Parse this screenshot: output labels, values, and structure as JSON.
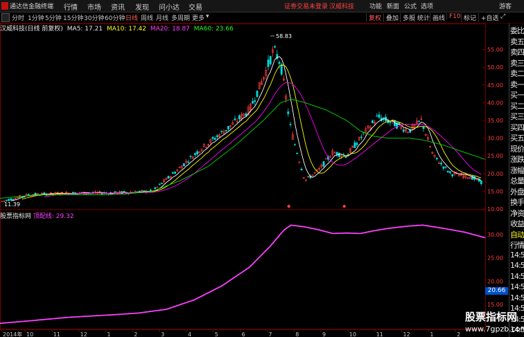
{
  "menubar": {
    "app_title": "通达信金融终端",
    "items": [
      "行情",
      "市场",
      "资讯",
      "发现",
      "问小达",
      "交易"
    ],
    "notice": "证劵交易未登录",
    "stock_name": "汉威科技",
    "right_items": [
      "功能",
      "新面",
      "公式",
      "选项"
    ],
    "user": "游客",
    "colors": {
      "notice": "#ff3030",
      "stock": "#ff3030"
    }
  },
  "toolbar": {
    "periods": [
      "分时",
      "1分钟",
      "5分钟",
      "15分钟",
      "30分钟",
      "60分钟",
      "日线",
      "周线",
      "月线",
      "多周期",
      "更多"
    ],
    "selected_period": "日线",
    "buttons": [
      "复权",
      "叠加",
      "多股",
      "统计",
      "画线",
      "F10",
      "标记",
      "+自选"
    ],
    "selected_buttons": [
      "复权",
      "F10"
    ]
  },
  "legend": {
    "title": "汉威科技(日线 前复权)",
    "ma5": "MA5: 17.21",
    "ma10": "MA10: 17.42",
    "ma20": "MA20: 18.87",
    "ma60": "MA60: 23.66",
    "colors": {
      "ma5": "#ffffff",
      "ma10": "#ffff00",
      "ma20": "#ff00ff",
      "ma60": "#00ff00"
    }
  },
  "sub_legend": {
    "name": "股票指标网",
    "indicator": "顶配线: 29.32",
    "value_tag": "20.66"
  },
  "price_axis": {
    "ticks": [
      "55.00",
      "50.00",
      "45.00",
      "40.00",
      "35.00",
      "30.00",
      "25.00",
      "20.00",
      "15.00",
      "10.00"
    ],
    "max_label": "58.83",
    "min_label": "11.39"
  },
  "sub_axis": {
    "ticks": [
      "30.00",
      "25.00",
      "20.00",
      "15.00"
    ]
  },
  "date_axis": {
    "labels": [
      "2014年",
      "10",
      "11",
      "12",
      "1",
      "2",
      "3",
      "4",
      "5",
      "6",
      "7",
      "8",
      "9",
      "10",
      "11",
      "12",
      "1",
      "2"
    ]
  },
  "right_panel": {
    "items": [
      {
        "t": "委比",
        "c": "wht"
      },
      {
        "t": "卖五",
        "c": "wht"
      },
      {
        "t": "卖四",
        "c": "wht"
      },
      {
        "t": "卖三",
        "c": "wht"
      },
      {
        "t": "卖二",
        "c": "wht"
      },
      {
        "t": "卖一",
        "c": "wht"
      },
      {
        "t": "买一",
        "c": "wht"
      },
      {
        "t": "买二",
        "c": "wht"
      },
      {
        "t": "买三",
        "c": "wht"
      },
      {
        "t": "买四",
        "c": "wht"
      },
      {
        "t": "买五",
        "c": "wht"
      },
      {
        "t": "现价",
        "c": "wht"
      },
      {
        "t": "涨跌",
        "c": "wht"
      },
      {
        "t": "涨幅",
        "c": "wht"
      },
      {
        "t": "总量",
        "c": "wht"
      },
      {
        "t": "外盘",
        "c": "wht"
      },
      {
        "t": "换手",
        "c": "wht"
      },
      {
        "t": "净资",
        "c": "wht"
      },
      {
        "t": "收益",
        "c": "wht"
      },
      {
        "t": "自动",
        "c": "yel"
      },
      {
        "t": "行情",
        "c": "wht"
      },
      {
        "t": "14:5",
        "c": "wht"
      },
      {
        "t": "14:5",
        "c": "wht"
      },
      {
        "t": "14:5",
        "c": "wht"
      },
      {
        "t": "14:5",
        "c": "wht"
      },
      {
        "t": "14:5",
        "c": "wht"
      },
      {
        "t": "14:5",
        "c": "wht"
      },
      {
        "t": "14:5",
        "c": "wht"
      },
      {
        "t": "14:5",
        "c": "wht"
      }
    ]
  },
  "watermark": {
    "line1": "股票指标网",
    "line2": "www.7gpzb.com"
  },
  "chart_data": {
    "type": "line",
    "price_range": [
      10,
      60
    ],
    "ma60": [
      [
        0,
        13
      ],
      [
        30,
        13.6
      ],
      [
        60,
        14
      ],
      [
        100,
        14
      ],
      [
        140,
        14
      ],
      [
        180,
        14.2
      ],
      [
        220,
        15
      ],
      [
        260,
        18
      ],
      [
        300,
        22
      ],
      [
        340,
        28
      ],
      [
        380,
        35
      ],
      [
        405,
        40
      ],
      [
        420,
        41
      ],
      [
        440,
        40
      ],
      [
        470,
        38
      ],
      [
        500,
        35
      ],
      [
        520,
        32
      ],
      [
        540,
        30.5
      ],
      [
        560,
        30
      ],
      [
        590,
        30
      ],
      [
        610,
        29.5
      ],
      [
        640,
        28
      ],
      [
        670,
        26
      ],
      [
        700,
        24
      ]
    ],
    "indicator_range": [
      10,
      35
    ],
    "indicator": [
      [
        0,
        11
      ],
      [
        40,
        11.5
      ],
      [
        100,
        12.3
      ],
      [
        160,
        12.8
      ],
      [
        200,
        13.2
      ],
      [
        240,
        14
      ],
      [
        280,
        16
      ],
      [
        320,
        19
      ],
      [
        360,
        23
      ],
      [
        390,
        27.5
      ],
      [
        410,
        31
      ],
      [
        420,
        32
      ],
      [
        440,
        31.6
      ],
      [
        460,
        31
      ],
      [
        480,
        30.2
      ],
      [
        500,
        30.3
      ],
      [
        520,
        30.2
      ],
      [
        540,
        30.8
      ],
      [
        560,
        31.3
      ],
      [
        590,
        31.8
      ],
      [
        610,
        32
      ],
      [
        640,
        31.3
      ],
      [
        670,
        30.5
      ],
      [
        700,
        29.3
      ]
    ]
  },
  "colors": {
    "background": "#000000",
    "border": "#7a0000",
    "grid": "#3a0000",
    "up": "#ff3c3c",
    "down": "#00dcdc",
    "indicator": "#ff40ff"
  }
}
